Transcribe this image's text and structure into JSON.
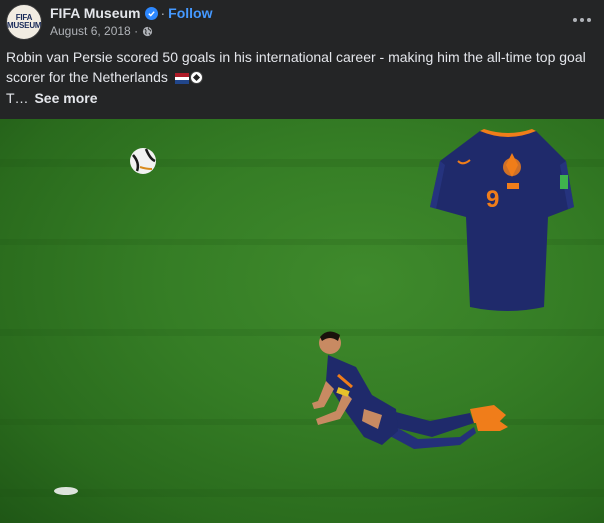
{
  "post": {
    "page_name": "FIFA Museum",
    "separator": "·",
    "follow_label": "Follow",
    "date": "August 6, 2018 ·",
    "caption": "Robin van Persie scored 50 goals in his international career - making him the all-time top goal scorer for the Netherlands",
    "truncated_text": "T…",
    "see_more_label": "See more"
  },
  "avatar": {
    "line1": "FIFA",
    "line2": "MUSEUM"
  },
  "photo": {
    "jersey_number": "9"
  },
  "colors": {
    "background": "#242526",
    "text_primary": "#e4e6eb",
    "text_secondary": "#b0b3b8",
    "link_blue": "#4599ff",
    "verified_blue": "#2d88ff",
    "pitch_green": "#357d25",
    "jersey_navy": "#1f2a6b",
    "oranje": "#f07d1a"
  },
  "icons": {
    "verified": "verified-badge-icon",
    "audience": "globe-icon",
    "more": "more-options-icon"
  }
}
